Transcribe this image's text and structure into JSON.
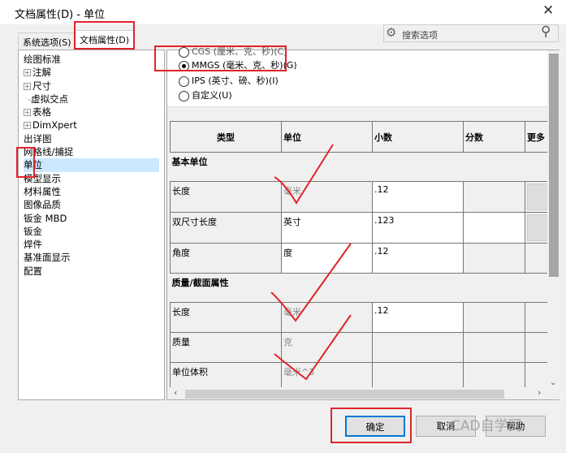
{
  "window": {
    "title": "文档属性(D) - 单位",
    "close": "✕"
  },
  "tabs": [
    {
      "label": "系统选项(S)"
    },
    {
      "label": "文档属性(D)"
    }
  ],
  "search": {
    "placeholder": "搜索选项"
  },
  "tree": [
    "绘图标准",
    "注解",
    "尺寸",
    "虚拟交点",
    "表格",
    "DimXpert",
    "出详图",
    "网格线/捕捉",
    "单位",
    "模型显示",
    "材料属性",
    "图像品质",
    "钣金 MBD",
    "钣金",
    "焊件",
    "基准面显示",
    "配置"
  ],
  "unit_system": {
    "options": [
      "CGS (厘米、克、秒)(C)",
      "MMGS (毫米、克、秒)(G)",
      "IPS (英寸、磅、秒)(I)",
      "自定义(U)"
    ],
    "selected": "MMGS (毫米、克、秒)(G)"
  },
  "table": {
    "headers": [
      "类型",
      "单位",
      "小数",
      "分数",
      "更多"
    ],
    "sections": [
      {
        "title": "基本单位",
        "rows": [
          [
            "长度",
            "毫米",
            ".12"
          ],
          [
            "双尺寸长度",
            "英寸",
            ".123"
          ],
          [
            "角度",
            "度",
            ".12"
          ]
        ]
      },
      {
        "title": "质量/截面属性",
        "rows": [
          [
            "长度",
            "毫米",
            ".12"
          ],
          [
            "质量",
            "克",
            ""
          ],
          [
            "单位体积",
            "毫米^3",
            ""
          ]
        ]
      }
    ]
  },
  "buttons": {
    "ok": "确定",
    "cancel": "取消",
    "help": "帮助"
  },
  "watermark": "CAD自学网",
  "colors": {
    "annotation": "#e0242a",
    "focus": "#0078d7"
  }
}
